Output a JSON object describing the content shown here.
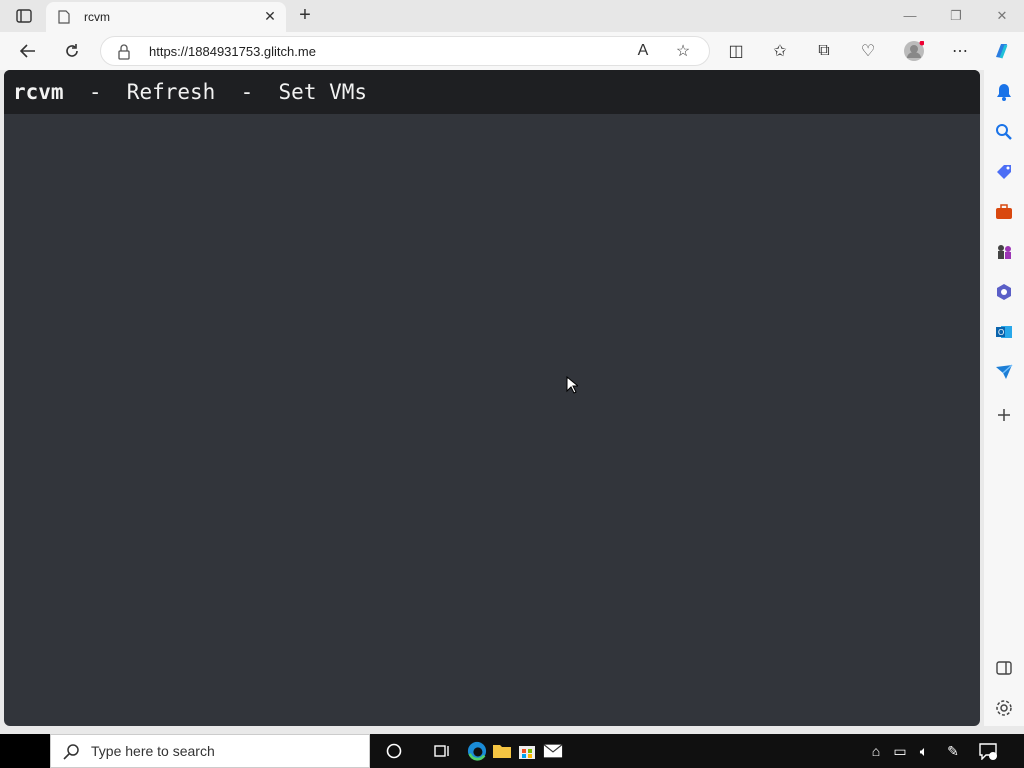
{
  "browser": {
    "tab_title": "rcvm",
    "tab_close_label": "✕",
    "new_tab_label": "+",
    "url": "https://1884931753.glitch.me"
  },
  "app": {
    "brand": "rcvm",
    "separator1": "  -  ",
    "refresh_label": "Refresh",
    "separator2": "  -  ",
    "set_vms_label": "Set VMs"
  },
  "taskbar": {
    "search_placeholder": "Type here to search"
  },
  "colors": {
    "page_bg": "#32353b",
    "header_bg": "#1e1f22",
    "header_text": "#f2f2f2"
  }
}
